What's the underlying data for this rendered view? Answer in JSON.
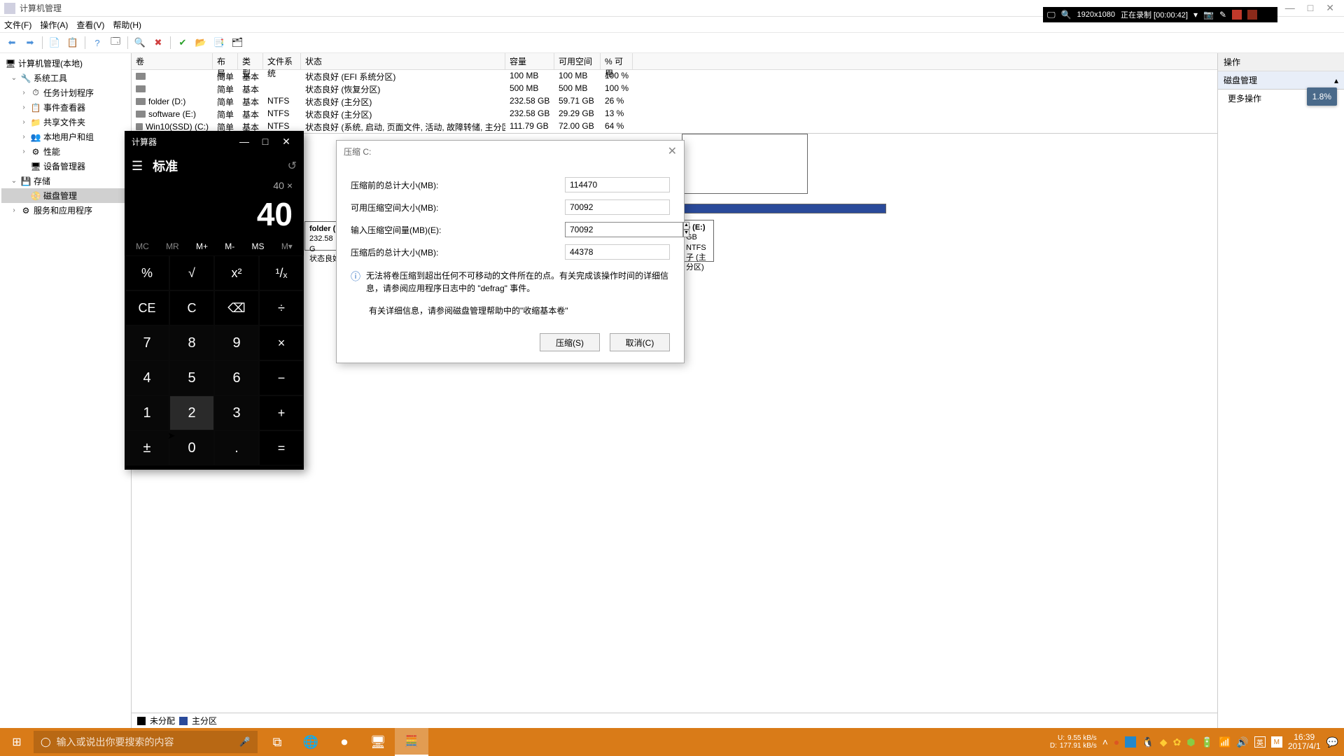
{
  "titlebar": {
    "title": "计算机管理"
  },
  "menubar": {
    "file": "文件(F)",
    "action": "操作(A)",
    "view": "查看(V)",
    "help": "帮助(H)"
  },
  "tree": {
    "root": "计算机管理(本地)",
    "systools": "系统工具",
    "sched": "任务计划程序",
    "event": "事件查看器",
    "shared": "共享文件夹",
    "users": "本地用户和组",
    "perf": "性能",
    "devmgr": "设备管理器",
    "storage": "存储",
    "diskmgmt": "磁盘管理",
    "services": "服务和应用程序"
  },
  "cols": {
    "vol": "卷",
    "layout": "布局",
    "type": "类型",
    "fs": "文件系统",
    "status": "状态",
    "cap": "容量",
    "free": "可用空间",
    "pct": "% 可用"
  },
  "rows": [
    {
      "vol": "",
      "layout": "简单",
      "type": "基本",
      "fs": "",
      "status": "状态良好 (EFI 系统分区)",
      "cap": "100 MB",
      "free": "100 MB",
      "pct": "100 %"
    },
    {
      "vol": "",
      "layout": "简单",
      "type": "基本",
      "fs": "",
      "status": "状态良好 (恢复分区)",
      "cap": "500 MB",
      "free": "500 MB",
      "pct": "100 %"
    },
    {
      "vol": "folder (D:)",
      "layout": "简单",
      "type": "基本",
      "fs": "NTFS",
      "status": "状态良好 (主分区)",
      "cap": "232.58 GB",
      "free": "59.71 GB",
      "pct": "26 %"
    },
    {
      "vol": "software (E:)",
      "layout": "简单",
      "type": "基本",
      "fs": "NTFS",
      "status": "状态良好 (主分区)",
      "cap": "232.58 GB",
      "free": "29.29 GB",
      "pct": "13 %"
    },
    {
      "vol": "Win10(SSD) (C:)",
      "layout": "简单",
      "type": "基本",
      "fs": "NTFS",
      "status": "状态良好 (系统, 启动, 页面文件, 活动, 故障转储, 主分区)",
      "cap": "111.79 GB",
      "free": "72.00 GB",
      "pct": "64 %"
    }
  ],
  "legend": {
    "unalloc": "未分配",
    "primary": "主分区"
  },
  "actions": {
    "hdr": "操作",
    "sect": "磁盘管理",
    "more": "更多操作"
  },
  "recorder": {
    "res": "1920x1080",
    "status": "正在录制 [00:00:42]",
    "badge": "1.8%"
  },
  "calc": {
    "title": "计算器",
    "mode": "标准",
    "expr": "40 ×",
    "display": "40",
    "mem": {
      "mc": "MC",
      "mr": "MR",
      "mplus": "M+",
      "mminus": "M-",
      "ms": "MS",
      "mlist": "M▾"
    },
    "keys": {
      "pct": "%",
      "sqrt": "√",
      "sq": "x²",
      "inv": "¹/ₓ",
      "ce": "CE",
      "c": "C",
      "bs": "⌫",
      "div": "÷",
      "k7": "7",
      "k8": "8",
      "k9": "9",
      "mul": "×",
      "k4": "4",
      "k5": "5",
      "k6": "6",
      "sub": "−",
      "k1": "1",
      "k2": "2",
      "k3": "3",
      "add": "+",
      "neg": "±",
      "k0": "0",
      "dot": ".",
      "eq": "="
    }
  },
  "dlg": {
    "title": "压缩 C:",
    "before_lbl": "压缩前的总计大小(MB):",
    "before_val": "114470",
    "avail_lbl": "可用压缩空间大小(MB):",
    "avail_val": "70092",
    "input_lbl": "输入压缩空间量(MB)(E):",
    "input_val": "70092",
    "after_lbl": "压缩后的总计大小(MB):",
    "after_val": "44378",
    "info": "无法将卷压缩到超出任何不可移动的文件所在的点。有关完成该操作时间的详细信息，请参阅应用程序日志中的 \"defrag\" 事件。",
    "link": "有关详细信息，请参阅磁盘管理帮助中的\"收缩基本卷\"",
    "shrink": "压缩(S)",
    "cancel": "取消(C)"
  },
  "disk_graph": {
    "folder": {
      "name": "folder  (",
      "size": "232.58 G",
      "status": "状态良好"
    },
    "frag": "页面文件, 活",
    "e": {
      "name": "e  (E:)",
      "size": "GB NTFS",
      "status": "子 (主分区)"
    }
  },
  "taskbar": {
    "search_ph": "输入或说出你要搜索的内容",
    "net": {
      "u_lbl": "U:",
      "u": "9.55 kB/s",
      "d_lbl": "D:",
      "d": "177.91 kB/s"
    },
    "time": "16:39",
    "date": "2017/4/1"
  }
}
